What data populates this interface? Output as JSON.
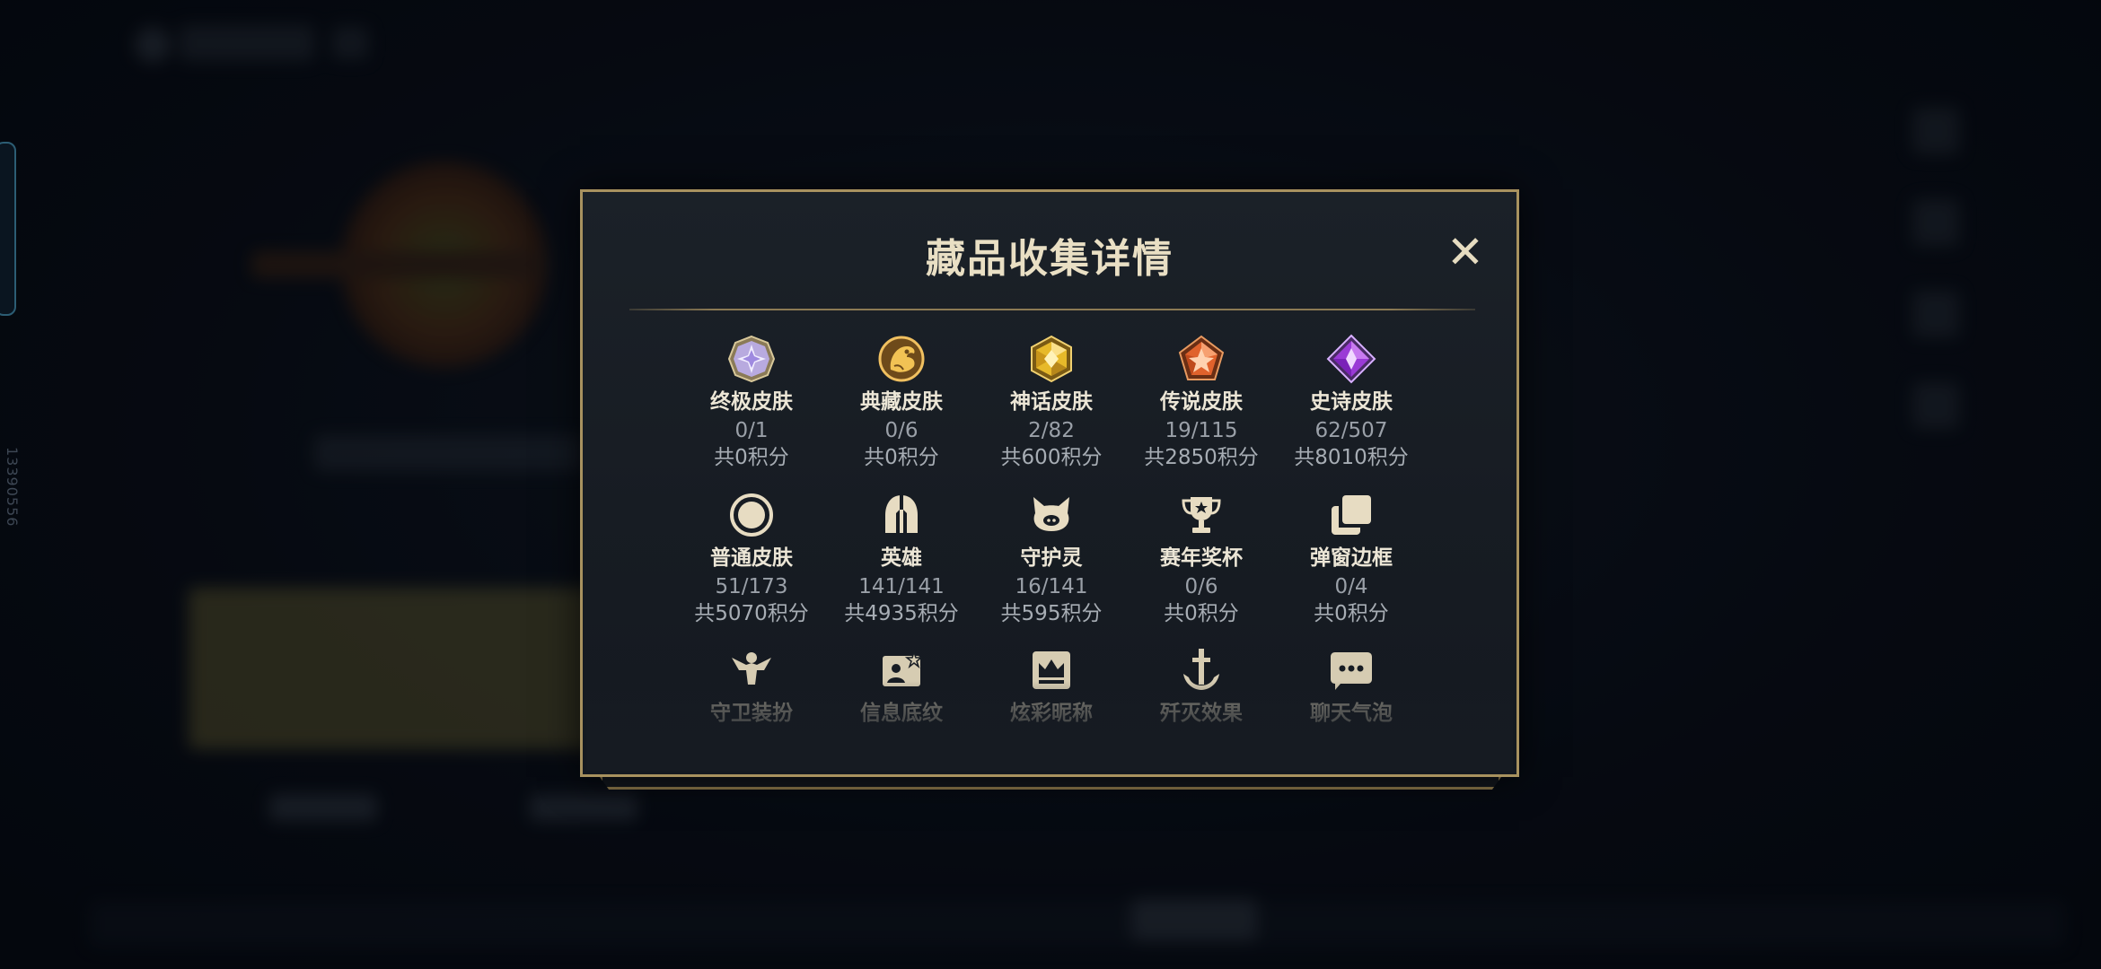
{
  "side": {
    "id_text": "13390556"
  },
  "modal": {
    "title": "藏品收集详情",
    "close_label": "✕",
    "items": [
      {
        "label": "终极皮肤",
        "count": "0/1",
        "points": "共0积分",
        "icon": "ultimate-skin-icon"
      },
      {
        "label": "典藏皮肤",
        "count": "0/6",
        "points": "共0积分",
        "icon": "collection-skin-icon"
      },
      {
        "label": "神话皮肤",
        "count": "2/82",
        "points": "共600积分",
        "icon": "mythic-skin-icon"
      },
      {
        "label": "传说皮肤",
        "count": "19/115",
        "points": "共2850积分",
        "icon": "legendary-skin-icon"
      },
      {
        "label": "史诗皮肤",
        "count": "62/507",
        "points": "共8010积分",
        "icon": "epic-skin-icon"
      },
      {
        "label": "普通皮肤",
        "count": "51/173",
        "points": "共5070积分",
        "icon": "normal-skin-icon"
      },
      {
        "label": "英雄",
        "count": "141/141",
        "points": "共4935积分",
        "icon": "hero-helmet-icon"
      },
      {
        "label": "守护灵",
        "count": "16/141",
        "points": "共595积分",
        "icon": "guardian-spirit-icon"
      },
      {
        "label": "赛年奖杯",
        "count": "0/6",
        "points": "共0积分",
        "icon": "trophy-icon"
      },
      {
        "label": "弹窗边框",
        "count": "0/4",
        "points": "共0积分",
        "icon": "popup-frame-icon"
      },
      {
        "label": "守卫装扮",
        "icon": "guardian-outfit-icon"
      },
      {
        "label": "信息底纹",
        "icon": "info-background-icon"
      },
      {
        "label": "炫彩昵称",
        "icon": "colorful-nickname-icon"
      },
      {
        "label": "歼灭效果",
        "icon": "annihilation-effect-icon"
      },
      {
        "label": "聊天气泡",
        "icon": "chat-bubble-icon"
      }
    ]
  },
  "colors": {
    "gold": "#a8925f",
    "title": "#e9dfc4",
    "text_dim": "#9aa0a8"
  }
}
